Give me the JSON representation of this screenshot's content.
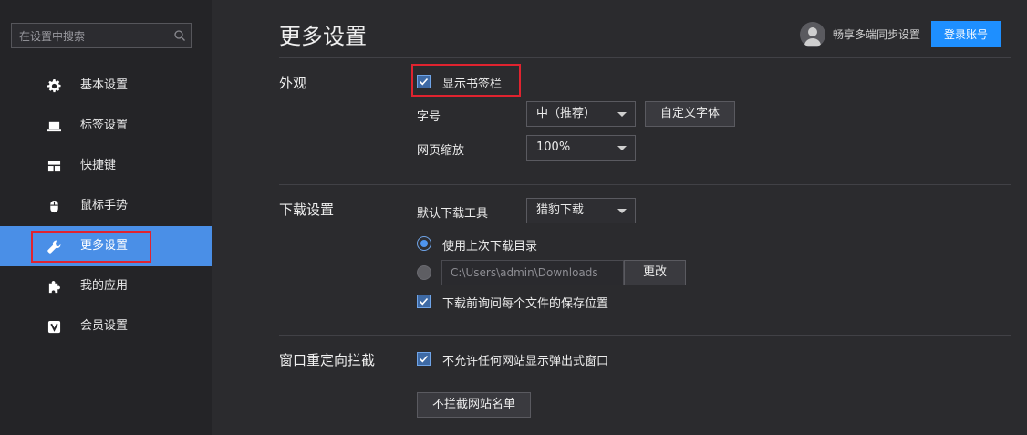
{
  "search": {
    "placeholder": "在设置中搜索",
    "icon": "search-icon"
  },
  "sidebar": {
    "items": [
      {
        "label": "基本设置",
        "icon": "gear-icon"
      },
      {
        "label": "标签设置",
        "icon": "laptop-icon"
      },
      {
        "label": "快捷键",
        "icon": "layout-icon"
      },
      {
        "label": "鼠标手势",
        "icon": "mouse-icon"
      },
      {
        "label": "更多设置",
        "icon": "wrench-icon",
        "active": true
      },
      {
        "label": "我的应用",
        "icon": "puzzle-icon"
      },
      {
        "label": "会员设置",
        "icon": "vip-icon"
      }
    ]
  },
  "header": {
    "title": "更多设置",
    "sync_text": "畅享多端同步设置",
    "login_button": "登录账号"
  },
  "appearance": {
    "section_title": "外观",
    "show_bookmark_bar": {
      "label": "显示书签栏",
      "checked": true
    },
    "font_size": {
      "label": "字号",
      "value": "中（推荐）"
    },
    "custom_font_button": "自定义字体",
    "page_zoom": {
      "label": "网页缩放",
      "value": "100%"
    }
  },
  "download": {
    "section_title": "下载设置",
    "default_tool": {
      "label": "默认下载工具",
      "value": "猎豹下载"
    },
    "use_last_dir": {
      "label": "使用上次下载目录",
      "selected": true
    },
    "custom_dir": {
      "path": "C:\\Users\\admin\\Downloads",
      "selected": false
    },
    "change_button": "更改",
    "ask_location": {
      "label": "下载前询问每个文件的保存位置",
      "checked": true
    }
  },
  "popup": {
    "section_title": "窗口重定向拦截",
    "block_popups": {
      "label": "不允许任何网站显示弹出式窗口",
      "checked": true
    },
    "whitelist_button": "不拦截网站名单"
  },
  "colors": {
    "accent": "#1e8fff",
    "active_nav": "#4a8fe7",
    "highlight_box": "#e0232f"
  }
}
